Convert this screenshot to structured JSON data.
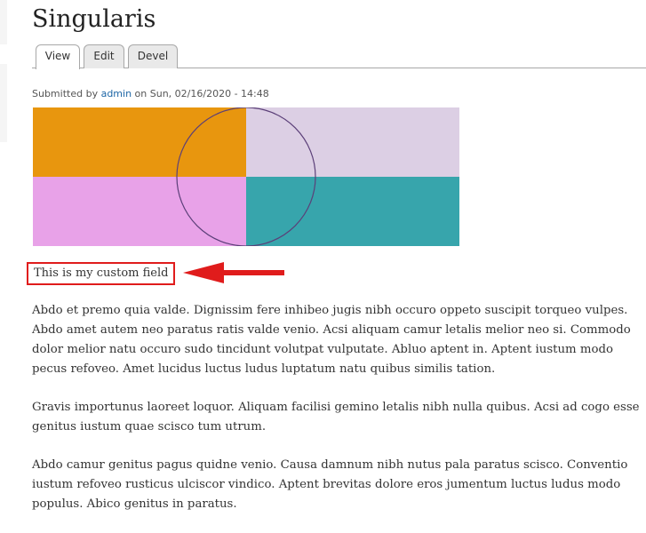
{
  "page": {
    "title": "Singularis"
  },
  "tabs": [
    {
      "label": "View",
      "active": true
    },
    {
      "label": "Edit",
      "active": false
    },
    {
      "label": "Devel",
      "active": false
    }
  ],
  "submitted": {
    "prefix": "Submitted by ",
    "author": "admin",
    "middle": " on ",
    "date": "Sun, 02/16/2020 - 14:48"
  },
  "image": {
    "colors": {
      "top_left": "#e8960e",
      "top_right": "#dccfe4",
      "bottom_left": "#e8a2e8",
      "bottom_right": "#37a5ac",
      "circle": "#5b3f78"
    }
  },
  "custom_field": {
    "text": "This is my custom field",
    "highlight_color": "#e01c1c"
  },
  "body": {
    "paragraphs": [
      "Abdo et premo quia valde. Dignissim fere inhibeo jugis nibh occuro oppeto suscipit torqueo vulpes. Abdo amet autem neo paratus ratis valde venio. Acsi aliquam camur letalis melior neo si. Commodo dolor melior natu occuro sudo tincidunt volutpat vulputate. Abluo aptent in. Aptent iustum modo pecus refoveo. Amet lucidus luctus ludus luptatum natu quibus similis tation.",
      "Gravis importunus laoreet loquor. Aliquam facilisi gemino letalis nibh nulla quibus. Acsi ad cogo esse genitus iustum quae scisco tum utrum.",
      "Abdo camur genitus pagus quidne venio. Causa damnum nibh nutus pala paratus scisco. Conventio iustum refoveo rusticus ulciscor vindico. Aptent brevitas dolore eros jumentum luctus ludus modo populus. Abico genitus in paratus."
    ]
  }
}
